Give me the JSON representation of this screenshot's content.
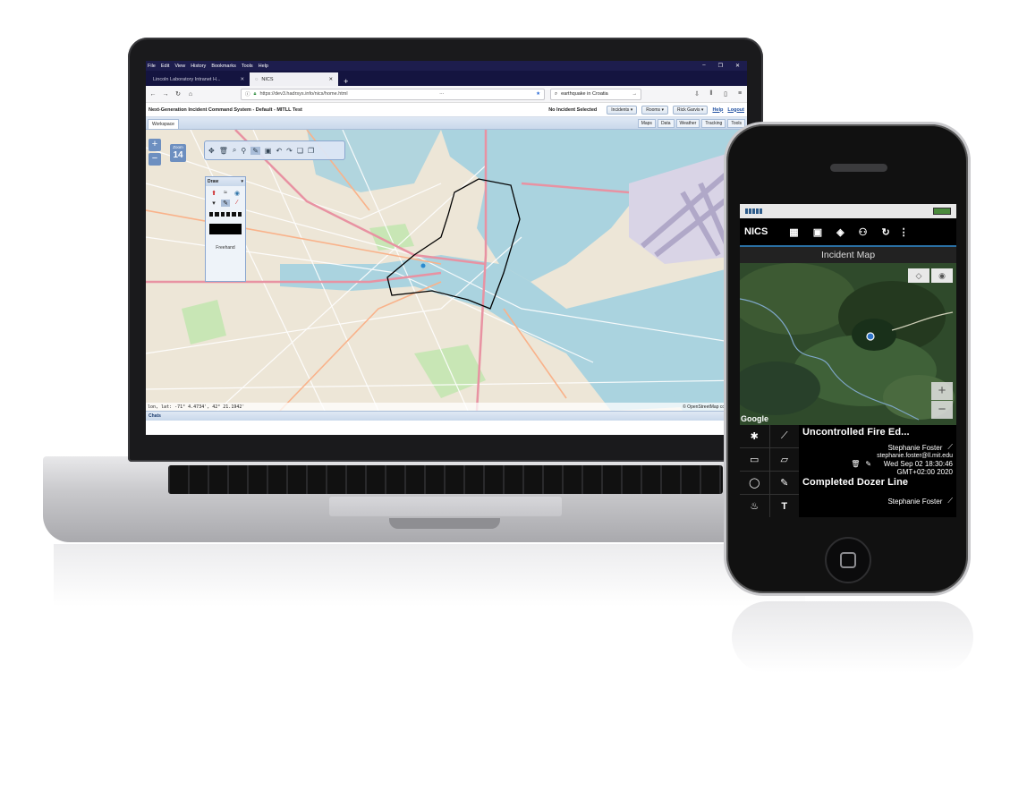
{
  "browser": {
    "menu": [
      "File",
      "Edit",
      "View",
      "History",
      "Bookmarks",
      "Tools",
      "Help"
    ],
    "tabs": [
      {
        "label": "Lincoln Laboratory Intranet H..."
      },
      {
        "label": "NICS"
      }
    ],
    "url": "https://dev3.hadrsys.info/nics/home.html",
    "search_value": "earthquake in Croatia"
  },
  "app": {
    "title": "Next-Generation Incident Command System - Default - MITLL Test",
    "incident_status": "No Incident Selected",
    "menus": [
      "Incidents ▾",
      "Rooms ▾",
      "Rick Garvis ▾"
    ],
    "help": "Help",
    "logout": "Logout",
    "workspace_tab": "Workspace",
    "right_tabs": [
      "Maps",
      "Data",
      "Weather",
      "Tracking",
      "Tools"
    ],
    "zoom_label": "Zoom",
    "zoom_value": "14",
    "draw_title": "Draw",
    "draw_mode": "Freehand",
    "coords": "lon, lat: -71° 4.4734', 42° 21.1942'",
    "attribution": "© OpenStreetMap contributors",
    "chats": "Chats"
  },
  "phone": {
    "app_name": "NICS",
    "subtitle": "Incident Map",
    "google": "Google",
    "items": [
      {
        "title": "Uncontrolled Fire Ed...",
        "author": "Stephanie Foster",
        "email": "stephanie.foster@ll.mit.edu",
        "date": "Wed Sep 02 18:30:46",
        "tz": "GMT+02:00 2020"
      },
      {
        "title": "Completed Dozer Line",
        "author": "Stephanie Foster"
      }
    ]
  },
  "colors": {
    "menubar": "#1d1d4d",
    "toolbar_blue": "#6d8fc0",
    "phone_accent": "#2a6fa3",
    "map_water": "#aad3df",
    "map_land": "#ede6d7"
  },
  "icons": {
    "map_tools": [
      "pan-icon",
      "delete-icon",
      "search-icon",
      "pin-icon",
      "pencil-icon",
      "image-icon",
      "undo-icon",
      "redo-icon",
      "copy-icon",
      "paste-icon"
    ],
    "phone_actions": [
      "map-icon",
      "contact-icon",
      "layers-icon",
      "group-icon",
      "refresh-icon",
      "more-icon"
    ],
    "phone_tools": [
      "marker-icon",
      "line-icon",
      "rectangle-icon",
      "polygon-icon",
      "circle-icon",
      "freehand-icon",
      "fire-icon",
      "text-icon"
    ]
  }
}
